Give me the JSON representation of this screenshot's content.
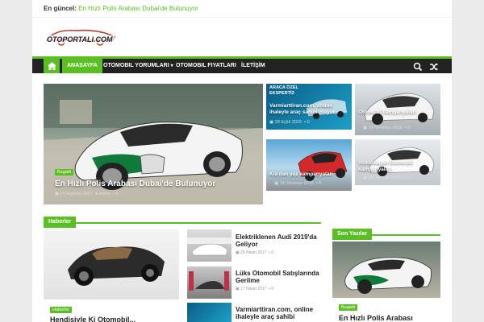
{
  "ticker": {
    "label": "En güncel:",
    "text": "En Hızlı Polis Arabası Dubai'de Bulunuyor"
  },
  "logo": {
    "text": "OTOPORTALI.COM"
  },
  "nav": {
    "items": [
      "ANASAYFA",
      "OTOMOBIL YORUMLARI",
      "OTOMOBIL FIYATLARI",
      "İLETİŞİM"
    ]
  },
  "hero": {
    "badge": "Bugatti",
    "title": "En Hızlı Polis Arabası Dubai'de Bulunuyor",
    "date": "21 Haziran 2017",
    "author": "editor",
    "comments": "0"
  },
  "tiles": [
    {
      "title": "Varmiarttiran.com, online ihaleyle araç sahibi oluyor",
      "date": "28 Eylül 2015",
      "comments": "0",
      "overlay": "ARACA ÖZEL EKSPERTİZ"
    },
    {
      "title": "Otomobil kampanyaları",
      "date": "14 Temmuz 2015",
      "comments": "0"
    },
    {
      "title": "Kia'dan yaz kampanyaları",
      "date": "14 Temmuz 2015",
      "comments": "0"
    },
    {
      "title": "Volkswagen Otomobil kampanyaları",
      "date": "08 Haziran 2015",
      "comments": "0"
    }
  ],
  "sections": {
    "haberler": "Haberler",
    "son_yazilar": "Son Yazılar"
  },
  "haberler_main": {
    "badge": "Haberler",
    "title": "Hendisiyle Ki Otomobil..."
  },
  "haberler_list": [
    {
      "title": "Elektriklenen Audi 2019'da Geliyor",
      "date": "25 Nisan 2017",
      "comments": "0"
    },
    {
      "title": "Lüks Otomobil Satışlarında Gerilme",
      "date": "17 Nisan 2017",
      "comments": "0"
    },
    {
      "title": "Varmiarttiran.com, online ihaleyle araç sahibi",
      "date": "",
      "comments": ""
    }
  ],
  "son_yazilar": {
    "badge": "Bugatti",
    "title": "En Hızlı Polis Arabası"
  },
  "colors": {
    "accent": "#5abf22",
    "dark": "#222222"
  }
}
